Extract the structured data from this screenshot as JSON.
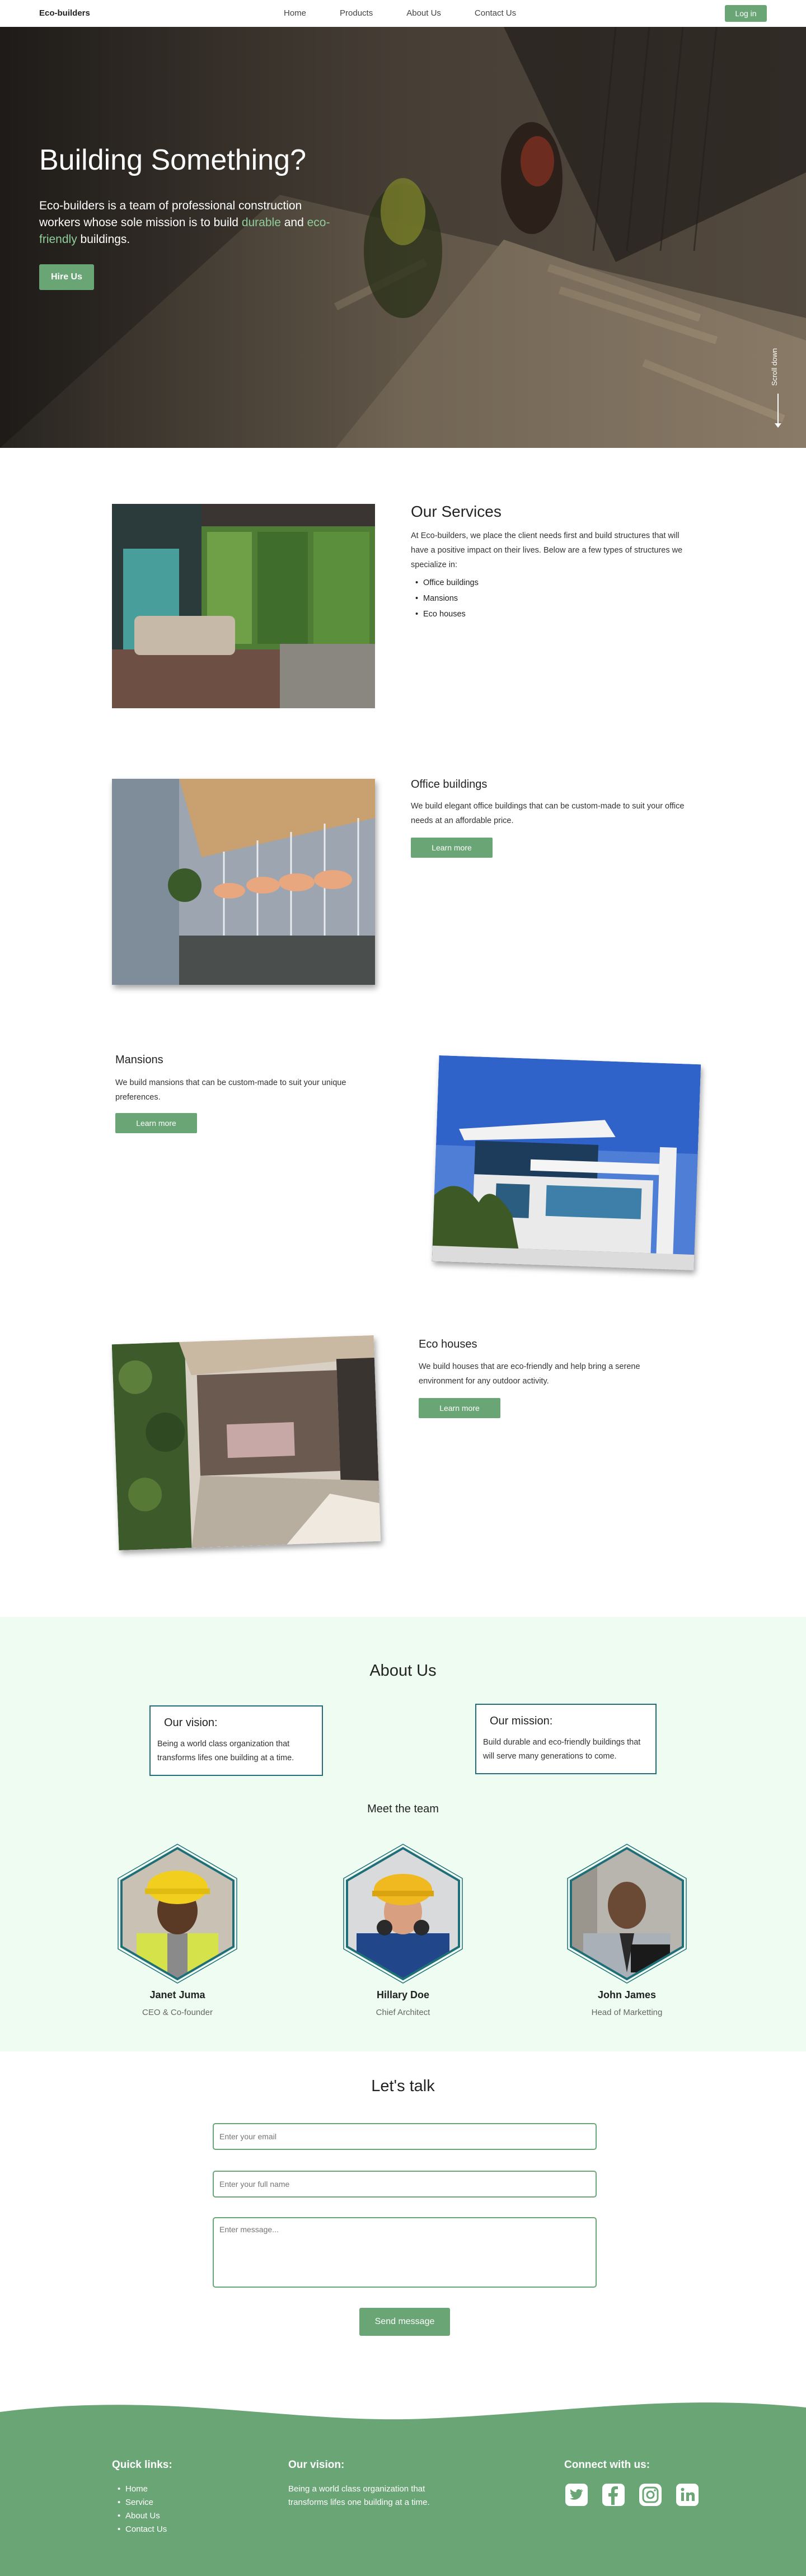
{
  "nav": {
    "brand": "Eco-builders",
    "links": [
      "Home",
      "Products",
      "About Us",
      "Contact Us"
    ],
    "login": "Log in"
  },
  "hero": {
    "title": "Building Something?",
    "text_a": "Eco-builders is a team of professional construction workers whose sole mission is to build ",
    "text_durable": "durable",
    "text_and": " and ",
    "text_eco": "eco-friendly",
    "text_end": " buildings.",
    "cta": "Hire Us",
    "scroll": "Scroll down"
  },
  "services": {
    "title": "Our Services",
    "text": "At Eco-builders, we place the client needs first and build structures that will have a positive impact on their lives. Below are a few types of structures we specialize in:",
    "list": [
      "Office buildings",
      "Mansions",
      "Eco houses"
    ]
  },
  "office": {
    "title": "Office buildings",
    "text": "We build elegant office buildings that can be custom-made to suit your office needs at an affordable price.",
    "button": "Learn more"
  },
  "mansions": {
    "title": "Mansions",
    "text": "We build mansions that can be custom-made to suit your unique preferences.",
    "button": "Learn more"
  },
  "eco": {
    "title": "Eco houses",
    "text": "We build houses that are eco-friendly and help bring a serene environment for any outdoor activity.",
    "button": "Learn more"
  },
  "about": {
    "title": "About Us",
    "vision_title": "Our vision:",
    "vision_text": "Being a world class organization that transforms lifes one building at a time.",
    "mission_title": "Our mission:",
    "mission_text": "Build durable and eco-friendly buildings that will serve many generations to come.",
    "team_title": "Meet the team",
    "team": [
      {
        "name": "Janet Juma",
        "role": "CEO & Co-founder"
      },
      {
        "name": "Hillary Doe",
        "role": "Chief Architect"
      },
      {
        "name": "John James",
        "role": "Head of Marketting"
      }
    ]
  },
  "contact": {
    "title": "Let's talk",
    "email_placeholder": "Enter your email",
    "name_placeholder": "Enter your full name",
    "message_placeholder": "Enter message...",
    "send": "Send message"
  },
  "footer": {
    "links_title": "Quick links:",
    "links": [
      "Home",
      "Service",
      "About Us",
      "Contact Us"
    ],
    "vision_title": "Our vision:",
    "vision_text": "Being a world class organization that transforms lifes one building at a time.",
    "connect_title": "Connect with us:",
    "socials": [
      "twitter-icon",
      "facebook-icon",
      "instagram-icon",
      "linkedin-icon"
    ]
  },
  "colors": {
    "accent": "#6aa576",
    "border_teal": "#1f6e78",
    "about_bg": "#eefcf1"
  }
}
